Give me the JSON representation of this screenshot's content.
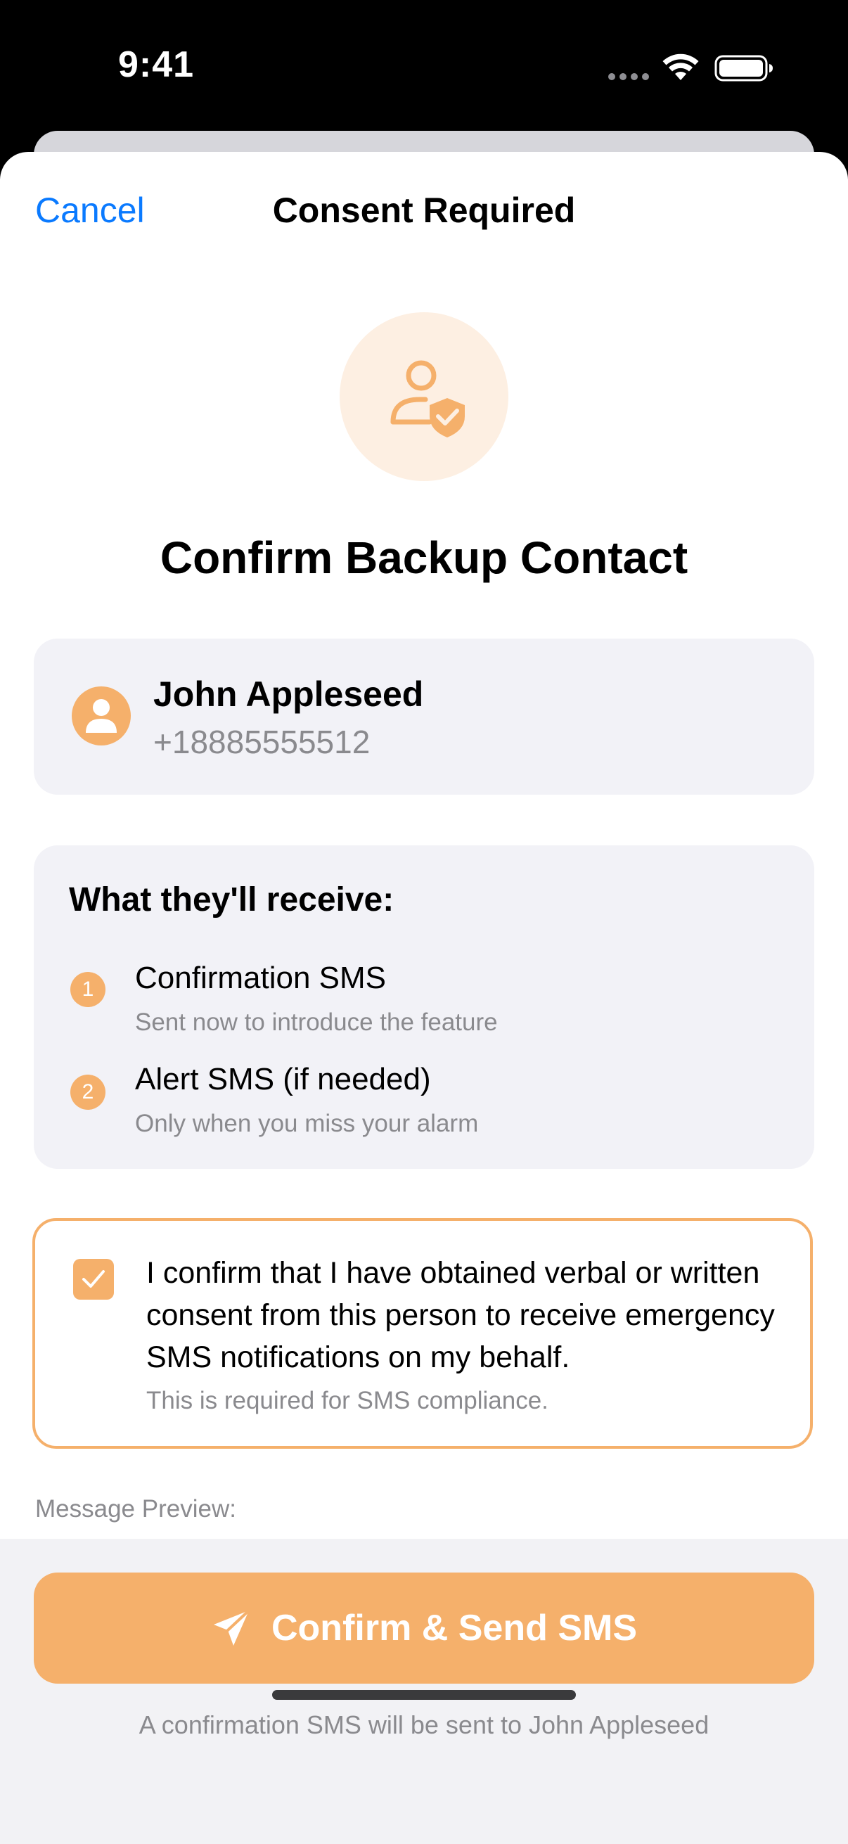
{
  "status_bar": {
    "time": "9:41",
    "icons": [
      "cellular-dots-icon",
      "wifi-icon",
      "battery-icon"
    ]
  },
  "nav": {
    "cancel_label": "Cancel",
    "title": "Consent Required"
  },
  "hero": {
    "icon": "person-shield-check-icon",
    "headline": "Confirm Backup Contact"
  },
  "contact": {
    "avatar_icon": "person-icon",
    "name": "John Appleseed",
    "phone": "+18885555512"
  },
  "receive": {
    "heading": "What they'll receive:",
    "items": [
      {
        "number": "1",
        "title": "Confirmation SMS",
        "subtitle": "Sent now to introduce the feature"
      },
      {
        "number": "2",
        "title": "Alert SMS (if needed)",
        "subtitle": "Only when you miss your alarm"
      }
    ]
  },
  "consent": {
    "checked": true,
    "text": "I confirm that I have obtained verbal or written consent from this person to receive emergency SMS notifications on my behalf.",
    "note": "This is required for SMS compliance."
  },
  "preview": {
    "label": "Message Preview:"
  },
  "footer": {
    "button_icon": "paper-plane-icon",
    "button_label": "Confirm & Send SMS",
    "note": "A confirmation SMS will be sent to John Appleseed"
  },
  "colors": {
    "accent": "#f5b06b",
    "accent_light": "#fdefe2",
    "link": "#0a7aff",
    "card_bg": "#f2f2f7",
    "secondary_text": "#8a8a8e"
  }
}
